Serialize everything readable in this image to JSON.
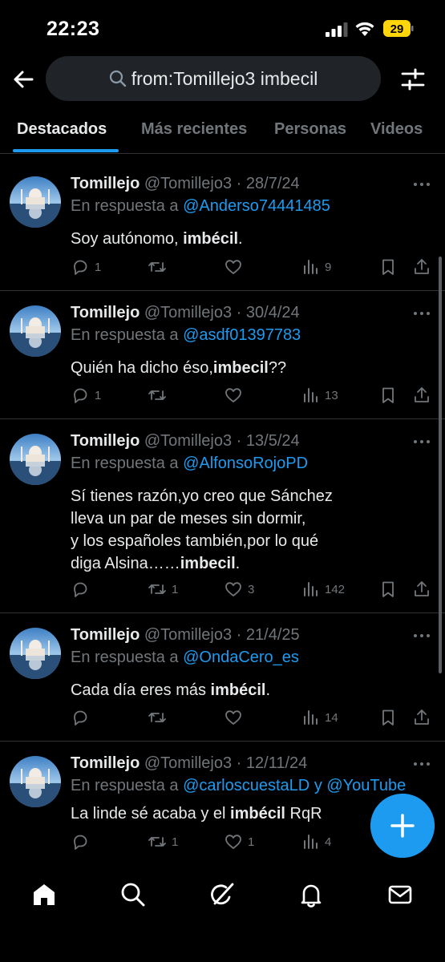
{
  "status_bar": {
    "time": "22:23",
    "battery": "29"
  },
  "search": {
    "query": "from:Tomillejo3 imbecil"
  },
  "tabs": [
    {
      "label": "Destacados",
      "active": true
    },
    {
      "label": "Más recientes",
      "active": false
    },
    {
      "label": "Personas",
      "active": false
    },
    {
      "label": "Videos",
      "active": false
    }
  ],
  "tweets": [
    {
      "name": "Tomillejo",
      "handle": "@Tomillejo3",
      "date": "28/7/24",
      "reply_prefix": "En respuesta a",
      "reply_to": "@Anderso74441485",
      "text_before": "Soy autónomo, ",
      "text_bold": "imbécil",
      "text_after": ".",
      "replies": "1",
      "retweets": "",
      "likes": "",
      "views": "9"
    },
    {
      "name": "Tomillejo",
      "handle": "@Tomillejo3",
      "date": "30/4/24",
      "reply_prefix": "En respuesta a",
      "reply_to": "@asdf01397783",
      "text_before": "Quién ha dicho éso,",
      "text_bold": "imbecil",
      "text_after": "??",
      "replies": "1",
      "retweets": "",
      "likes": "",
      "views": "13"
    },
    {
      "name": "Tomillejo",
      "handle": "@Tomillejo3",
      "date": "13/5/24",
      "reply_prefix": "En respuesta a",
      "reply_to": "@AlfonsoRojoPD",
      "text_lines": [
        "Sí tienes razón,yo creo que Sánchez",
        "lleva un par de meses sin dormir,",
        "y los españoles también,por lo qué"
      ],
      "text_before": "diga Alsina……",
      "text_bold": "imbecil",
      "text_after": ".",
      "replies": "",
      "retweets": "1",
      "likes": "3",
      "views": "142"
    },
    {
      "name": "Tomillejo",
      "handle": "@Tomillejo3",
      "date": "21/4/25",
      "reply_prefix": "En respuesta a",
      "reply_to": "@OndaCero_es",
      "text_before": "Cada día eres más ",
      "text_bold": "imbécil",
      "text_after": ".",
      "replies": "",
      "retweets": "",
      "likes": "",
      "views": "14"
    },
    {
      "name": "Tomillejo",
      "handle": "@Tomillejo3",
      "date": "12/11/24",
      "reply_prefix": "En respuesta a",
      "reply_to": "@carloscuestaLD",
      "reply_joiner": "y",
      "reply_to_2": "@YouTube",
      "text_before": "La linde sé acaba y el ",
      "text_bold": "imbécil",
      "text_after": " RqR",
      "replies": "",
      "retweets": "1",
      "likes": "1",
      "views": "4"
    }
  ],
  "icons": {
    "back": "arrow-left-icon",
    "search": "search-icon",
    "filter": "sliders-icon",
    "reply": "reply-icon",
    "retweet": "retweet-icon",
    "like": "heart-icon",
    "views": "views-icon",
    "bookmark": "bookmark-icon",
    "share": "share-icon",
    "compose": "plus-icon",
    "nav": [
      "home-icon",
      "explore-icon",
      "grok-icon",
      "notifications-icon",
      "messages-icon"
    ]
  },
  "colors": {
    "accent": "#1d9bf0",
    "background": "#000000",
    "muted": "#71767b",
    "text": "#e7e9ea",
    "battery": "#ffd60a"
  }
}
